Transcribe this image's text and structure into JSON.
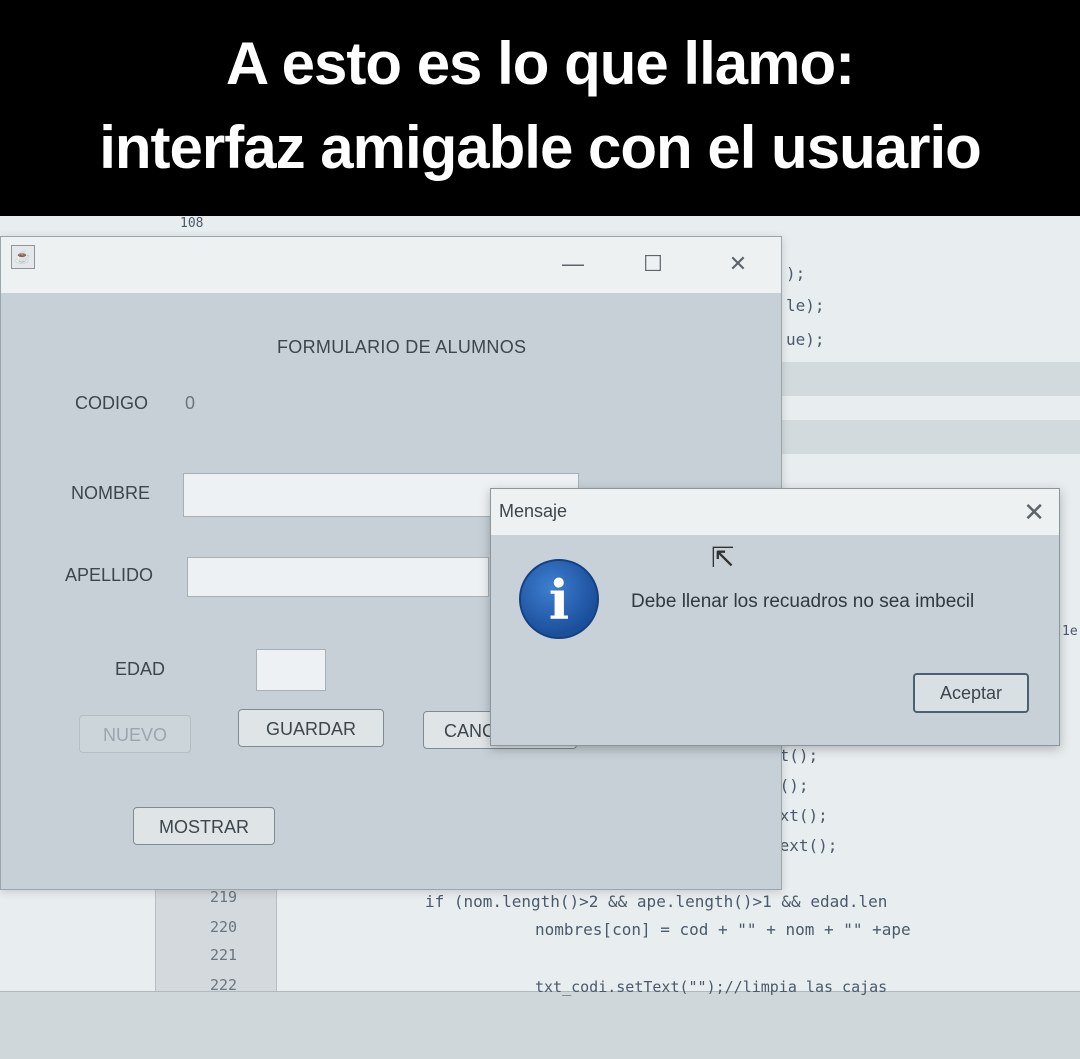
{
  "caption": {
    "line1": "A esto es lo que llamo:",
    "line2": "interfaz amigable con el usuario"
  },
  "ide": {
    "top_fragment": "108",
    "right_code": [
      ");",
      "le);",
      "ue);",
      "xt();",
      "t();",
      "ext();",
      "Text();",
      "1e"
    ],
    "line_numbers": [
      "219",
      "220",
      "221",
      "222"
    ],
    "code_219": "if (nom.length()>2 && ape.length()>1 && edad.len",
    "code_220": "nombres[con] = cod + \"\" + nom + \"\" +ape",
    "code_222": "txt_codi.setText(\"\");//limpia las cajas"
  },
  "window": {
    "icon": "java-icon",
    "minimize": "—",
    "maximize": "☐",
    "close": "✕",
    "form_title": "FORMULARIO DE ALUMNOS",
    "codigo_label": "CODIGO",
    "codigo_value": "0",
    "nombre_label": "NOMBRE",
    "apellido_label": "APELLIDO",
    "edad_label": "EDAD",
    "nuevo_button": "NUEVO",
    "guardar_button": "GUARDAR",
    "cancelar_button": "CANC",
    "mostrar_button": "MOSTRAR"
  },
  "dialog": {
    "title": "Mensaje",
    "close": "✕",
    "icon": "info-icon",
    "icon_glyph": "i",
    "message": "Debe llenar los recuadros no sea imbecil",
    "ok_button": "Aceptar"
  },
  "colors": {
    "caption_bg": "#000000",
    "caption_text": "#ffffff",
    "info_icon": "#1b4f9c"
  }
}
